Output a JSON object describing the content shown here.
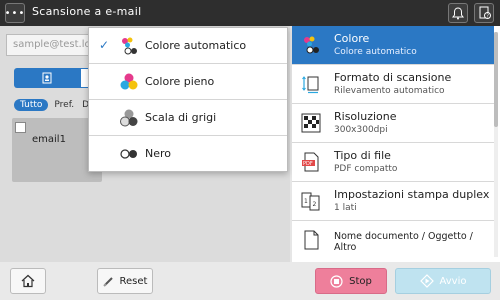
{
  "titlebar": {
    "menu_glyph": "•••",
    "title": "Scansione a e-mail",
    "icons": [
      "bell-icon",
      "help-icon"
    ]
  },
  "left": {
    "address_placeholder": "sample@test.lo",
    "filters": [
      "Tutto",
      "Pref.",
      "D"
    ],
    "email_item": "email1"
  },
  "dropdown": {
    "items": [
      {
        "label": "Colore automatico",
        "icon": "auto-color-icon",
        "selected": true
      },
      {
        "label": "Colore pieno",
        "icon": "full-color-icon",
        "selected": false
      },
      {
        "label": "Scala di grigi",
        "icon": "grayscale-icon",
        "selected": false
      },
      {
        "label": "Nero",
        "icon": "black-icon",
        "selected": false
      }
    ],
    "check_glyph": "✓"
  },
  "settings": {
    "items": [
      {
        "title": "Colore",
        "sub": "Colore automatico",
        "icon": "color-icon",
        "selected": true
      },
      {
        "title": "Formato di scansione",
        "sub": "Rilevamento automatico",
        "icon": "scan-size-icon",
        "selected": false
      },
      {
        "title": "Risoluzione",
        "sub": "300x300dpi",
        "icon": "resolution-icon",
        "selected": false
      },
      {
        "title": "Tipo di file",
        "sub": "PDF compatto",
        "icon": "file-type-icon",
        "selected": false
      },
      {
        "title": "Impostazioni stampa duplex",
        "sub": "1 lati",
        "icon": "duplex-icon",
        "selected": false
      },
      {
        "title": "Nome documento / Oggetto / Altro",
        "sub": "",
        "icon": "document-icon",
        "selected": false
      }
    ]
  },
  "bottom": {
    "reset_label": "Reset",
    "stop_label": "Stop",
    "start_label": "Avvio"
  },
  "colors": {
    "accent": "#2b78c4",
    "stop": "#ee7f9b",
    "start": "#bfe3f0",
    "titlebar": "#2e2e2e"
  }
}
